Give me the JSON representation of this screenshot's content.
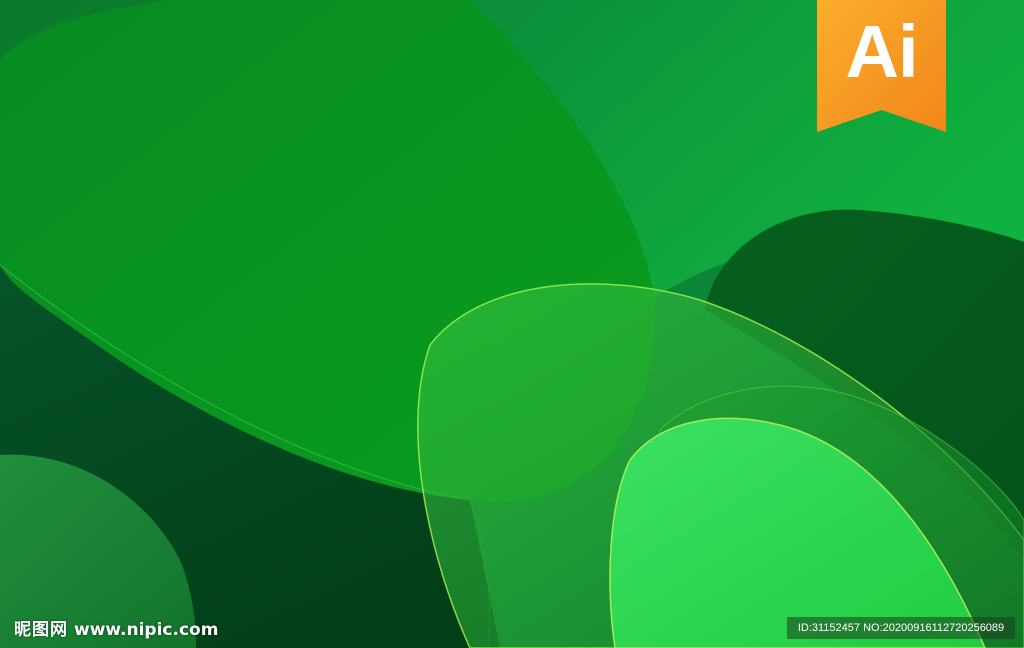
{
  "badge": {
    "text": "Ai",
    "color": "#f7921e"
  },
  "watermark": {
    "site_name": "昵图网",
    "site_url": "www.nipic.com",
    "image_info": "ID:31152457 NO:20200916112720256089"
  },
  "colors": {
    "base": "#0b6a2a",
    "dark": "#024d1d",
    "bright": "#2bdc4c",
    "outline": "#8eea3c"
  }
}
